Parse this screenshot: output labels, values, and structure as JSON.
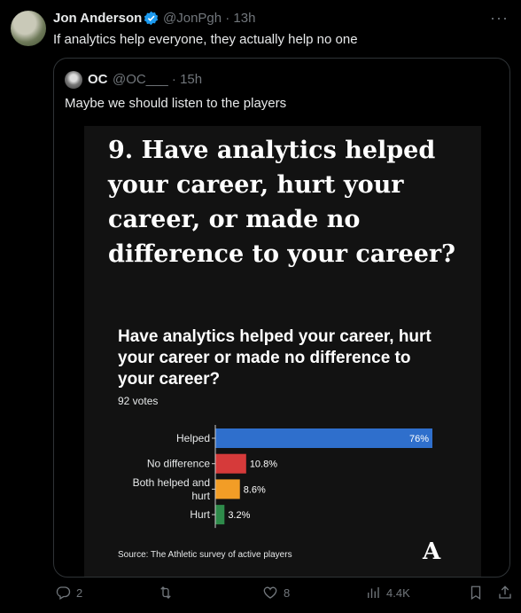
{
  "tweet": {
    "author_name": "Jon Anderson",
    "handle_time": "@JonPgh · 13h",
    "text": "If analytics help everyone, they actually help no one"
  },
  "quote": {
    "author_name": "OC",
    "handle_time": "@OC___ · 15h",
    "text": "Maybe we should listen to the players"
  },
  "card": {
    "big_question": "9. Have analytics helped your career, hurt your career, or made no difference to your career?",
    "source": "Source: The Athletic survey of active players",
    "logo": "A"
  },
  "chart_data": {
    "type": "bar",
    "orientation": "horizontal",
    "title": "Have analytics helped your career, hurt your career or made no difference to your career?",
    "subtitle": "92 votes",
    "categories": [
      "Helped",
      "No difference",
      "Both helped and hurt",
      "Hurt"
    ],
    "values": [
      76,
      10.8,
      8.6,
      3.2
    ],
    "value_labels": [
      "76%",
      "10.8%",
      "8.6%",
      "3.2%"
    ],
    "colors": [
      "#2f6fcc",
      "#d63a3a",
      "#f29d26",
      "#2e8b4a"
    ],
    "xlim": [
      0,
      76
    ]
  },
  "actions": {
    "replies": "2",
    "retweets": "",
    "likes": "8",
    "views": "4.4K"
  },
  "colors": {
    "accent": "#1d9bf0",
    "muted": "#71767b"
  }
}
